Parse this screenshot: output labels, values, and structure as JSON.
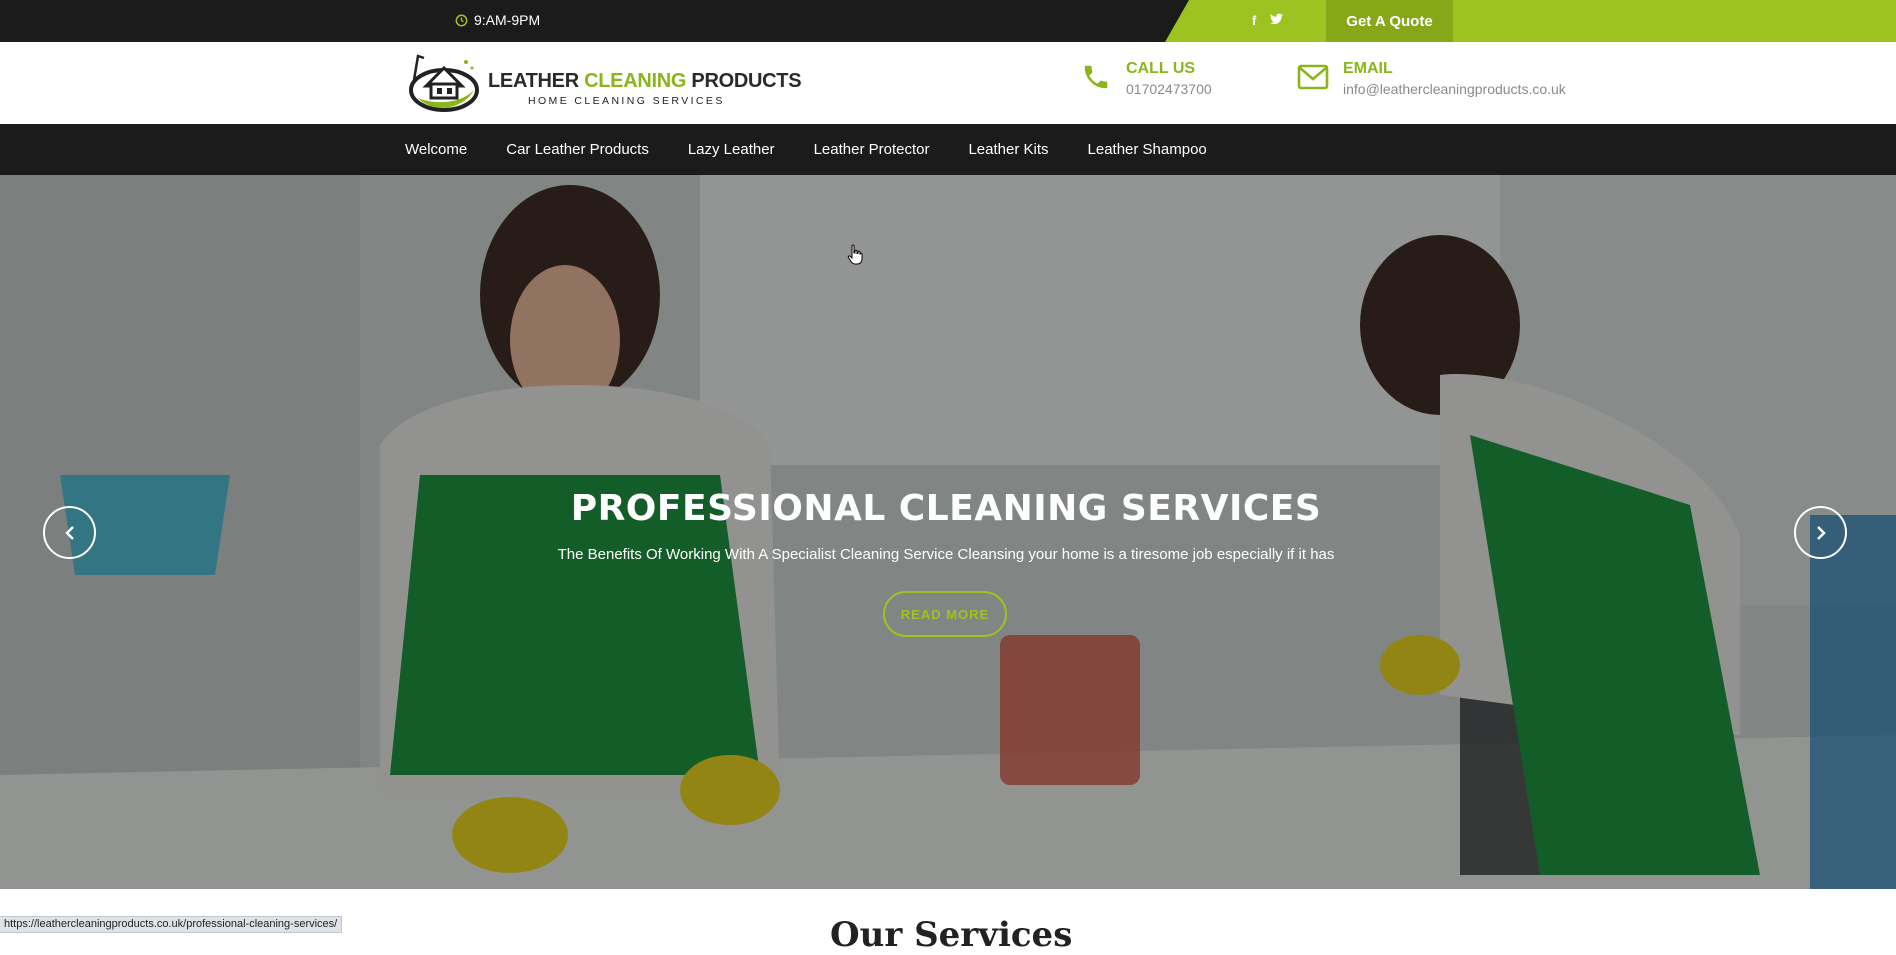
{
  "topbar": {
    "hours": "9:AM-9PM",
    "social": [
      "facebook-icon",
      "twitter-icon"
    ],
    "quote_button": "Get A Quote"
  },
  "header": {
    "logo": {
      "line1_a": "LEATHER ",
      "line1_b": "CLEANING",
      "line1_c": " PRODUCTS",
      "line2": "HOME CLEANING SERVICES"
    },
    "call": {
      "title": "CALL US",
      "value": "01702473700"
    },
    "email": {
      "title": "EMAIL",
      "value": "info@leathercleaningproducts.co.uk"
    }
  },
  "nav": {
    "items": [
      {
        "label": "Welcome"
      },
      {
        "label": "Car Leather Products"
      },
      {
        "label": "Lazy Leather"
      },
      {
        "label": "Leather Protector"
      },
      {
        "label": "Leather Kits"
      },
      {
        "label": "Leather Shampoo"
      }
    ]
  },
  "hero": {
    "title": "PROFESSIONAL CLEANING SERVICES",
    "subtitle": "The Benefits Of Working With A Specialist Cleaning Service Cleansing your home is a tiresome job especially if it has",
    "read_more": "READ MORE"
  },
  "section": {
    "heading_partial": "Our Services"
  },
  "status_url": "https://leathercleaningproducts.co.uk/professional-cleaning-services/",
  "colors": {
    "accent": "#9cc31f",
    "dark": "#1b1b1b"
  }
}
